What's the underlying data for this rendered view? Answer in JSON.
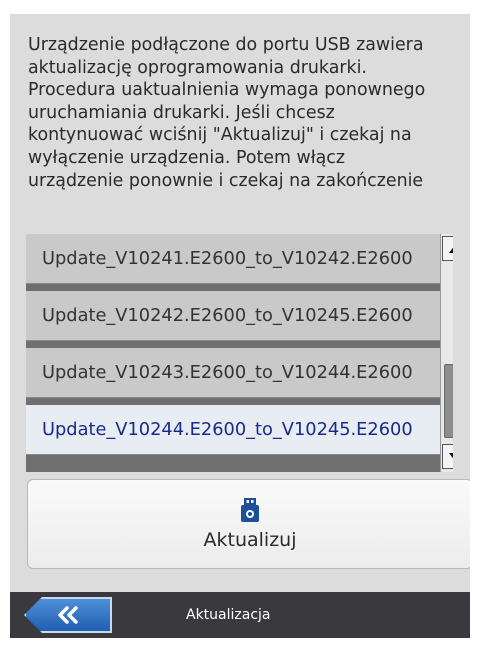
{
  "message": "Urządzenie podłączone do portu USB zawiera\naktualizację oprogramowania drukarki.\nProcedura uaktualnienia wymaga ponownego\nuruchamiania drukarki. Jeśli chcesz\nkontynuować wciśnij \"Aktualizuj\" i czekaj na\nwyłączenie urządzenia. Potem włącz\nurządzenie ponownie i czekaj na zakończenie",
  "update_list": {
    "items": [
      {
        "label": "Update_V10241.E2600_to_V10242.E2600"
      },
      {
        "label": "Update_V10242.E2600_to_V10245.E2600"
      },
      {
        "label": "Update_V10243.E2600_to_V10244.E2600"
      },
      {
        "label": "Update_V10244.E2600_to_V10245.E2600"
      }
    ],
    "selected_index": 3
  },
  "action_button": {
    "label": "Aktualizuj",
    "icon": "usb-drive-icon"
  },
  "bottom_bar": {
    "title": "Aktualizacja",
    "back_icon": "double-chevron-left-icon"
  },
  "colors": {
    "background": "#dcdcdc",
    "list_background": "#6f6f6f",
    "item": "#c9c9c9",
    "item_selected": "#e8edf3",
    "selected_text": "#1a2a8c",
    "bottom_bar": "#3a3a3e",
    "back_button": "#2f74c8"
  }
}
